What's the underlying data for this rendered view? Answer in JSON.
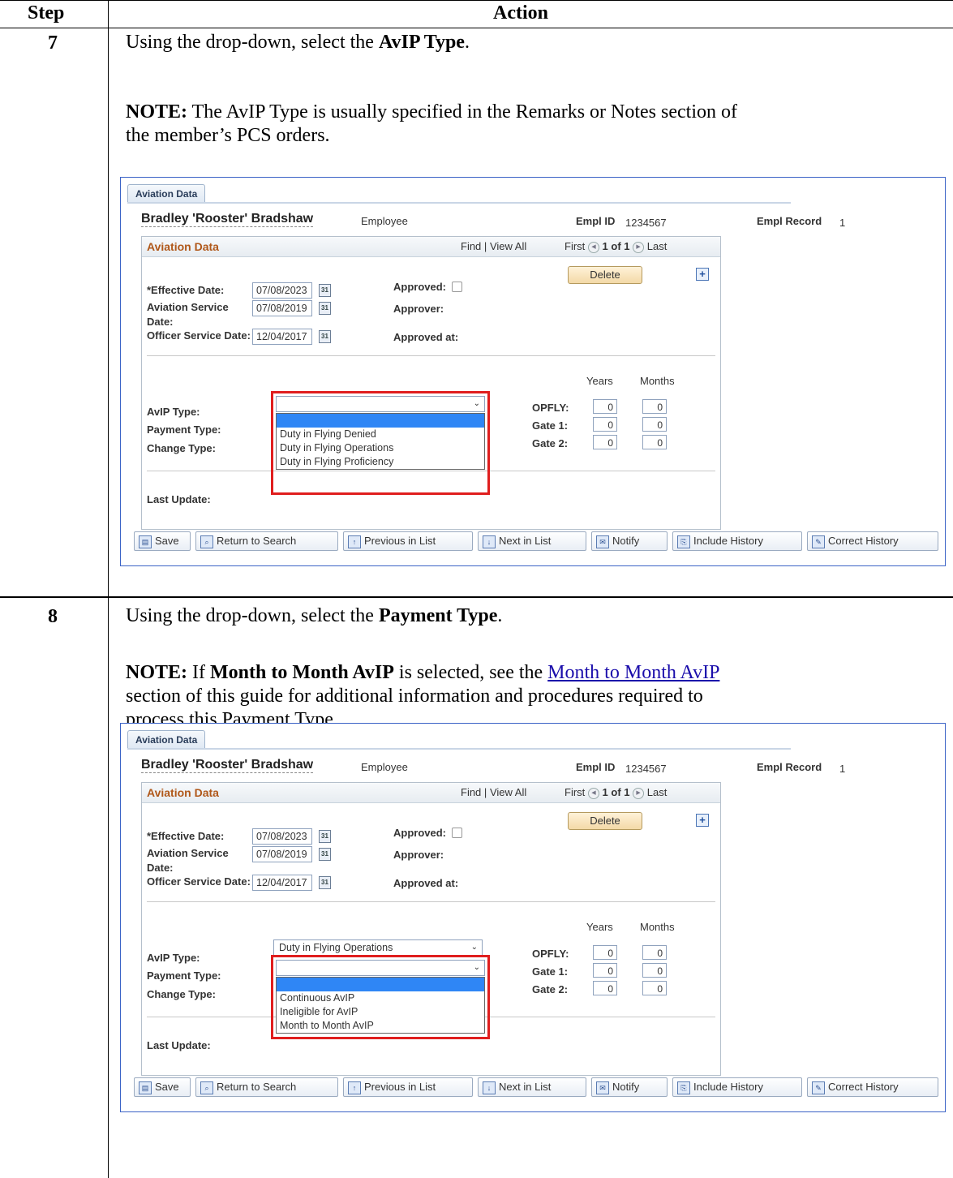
{
  "table": {
    "headers": {
      "step": "Step",
      "action": "Action"
    },
    "rows": [
      {
        "step": "7",
        "line1_pre": "Using the drop-down, select the ",
        "line1_bold": "AvIP Type",
        "line1_post": ".",
        "note_label": "NOTE:",
        "note_line1": " The AvIP Type is usually specified in the Remarks or Notes section of",
        "note_line2": "the member’s PCS orders."
      },
      {
        "step": "8",
        "line1_pre": "Using the drop-down, select the ",
        "line1_bold": "Payment Type",
        "line1_post": ".",
        "note_label": "NOTE:",
        "note_if": " If ",
        "note_bold": "Month to Month AvIP",
        "note_mid": " is selected, see the ",
        "note_link": "Month to Month AvIP",
        "note_line2": "section of this guide for additional information and procedures required to",
        "note_line3": "process this Payment Type."
      }
    ]
  },
  "screens": [
    {
      "tab_label": "Aviation Data",
      "employee_name": "Bradley 'Rooster' Bradshaw",
      "employee_role": "Employee",
      "empl_id_label": "Empl ID",
      "empl_id": "1234567",
      "empl_record_label": "Empl Record",
      "empl_record": "1",
      "grid_title": "Aviation Data",
      "find": "Find",
      "sep": "|",
      "view_all": "View All",
      "first": "First",
      "counter": "1 of 1",
      "last": "Last",
      "delete": "Delete",
      "effective_date_label": "*Effective Date:",
      "effective_date": "07/08/2023",
      "aviation_service_label1": "Aviation Service",
      "aviation_service_label2": "Date:",
      "aviation_service_date": "07/08/2019",
      "officer_service_label": "Officer Service Date:",
      "officer_service_date": "12/04/2017",
      "approved_label": "Approved:",
      "approver_label": "Approver:",
      "approved_at_label": "Approved at:",
      "years_label": "Years",
      "months_label": "Months",
      "avip_type_label": "AvIP Type:",
      "avip_type_value": "",
      "payment_type_label": "Payment Type:",
      "payment_type_value": "",
      "change_type_label": "Change Type:",
      "opfly_label": "OPFLY:",
      "gate1_label": "Gate 1:",
      "gate2_label": "Gate 2:",
      "opfly_years": "0",
      "opfly_months": "0",
      "gate1_years": "0",
      "gate1_months": "0",
      "gate2_years": "0",
      "gate2_months": "0",
      "dropdown_options": [
        "",
        "Duty in Flying Denied",
        "Duty in Flying Operations",
        "Duty in Flying Proficiency"
      ],
      "last_update_label": "Last Update:"
    },
    {
      "tab_label": "Aviation Data",
      "employee_name": "Bradley 'Rooster' Bradshaw",
      "employee_role": "Employee",
      "empl_id_label": "Empl ID",
      "empl_id": "1234567",
      "empl_record_label": "Empl Record",
      "empl_record": "1",
      "grid_title": "Aviation Data",
      "find": "Find",
      "sep": "|",
      "view_all": "View All",
      "first": "First",
      "counter": "1 of 1",
      "last": "Last",
      "delete": "Delete",
      "effective_date_label": "*Effective Date:",
      "effective_date": "07/08/2023",
      "aviation_service_label1": "Aviation Service",
      "aviation_service_label2": "Date:",
      "aviation_service_date": "07/08/2019",
      "officer_service_label": "Officer Service Date:",
      "officer_service_date": "12/04/2017",
      "approved_label": "Approved:",
      "approver_label": "Approver:",
      "approved_at_label": "Approved at:",
      "years_label": "Years",
      "months_label": "Months",
      "avip_type_label": "AvIP Type:",
      "avip_type_value": "Duty in Flying Operations",
      "payment_type_label": "Payment Type:",
      "payment_type_value": "",
      "change_type_label": "Change Type:",
      "opfly_label": "OPFLY:",
      "gate1_label": "Gate 1:",
      "gate2_label": "Gate 2:",
      "opfly_years": "0",
      "opfly_months": "0",
      "gate1_years": "0",
      "gate1_months": "0",
      "gate2_years": "0",
      "gate2_months": "0",
      "dropdown_options": [
        "",
        "Continuous AvIP",
        "Ineligible for AvIP",
        "Month to Month AvIP"
      ],
      "last_update_label": "Last Update:"
    }
  ],
  "toolbar": {
    "save": "Save",
    "return_to_search": "Return to Search",
    "previous_in_list": "Previous in List",
    "next_in_list": "Next in List",
    "notify": "Notify",
    "include_history": "Include History",
    "correct_history": "Correct History"
  },
  "icons": {
    "calendar": "calendar-icon",
    "prev": "prev-arrow-icon",
    "next": "next-arrow-icon",
    "add": "plus-icon",
    "save": "save-icon",
    "search": "search-icon",
    "prev_list": "previous-list-icon",
    "next_list": "next-list-icon",
    "notify": "notify-icon",
    "include_history": "include-history-icon",
    "correct_history": "correct-history-icon"
  },
  "colors": {
    "highlight_box": "#e01e1e",
    "selected_option": "#2f86f5",
    "grid_title": "#b0581a"
  }
}
